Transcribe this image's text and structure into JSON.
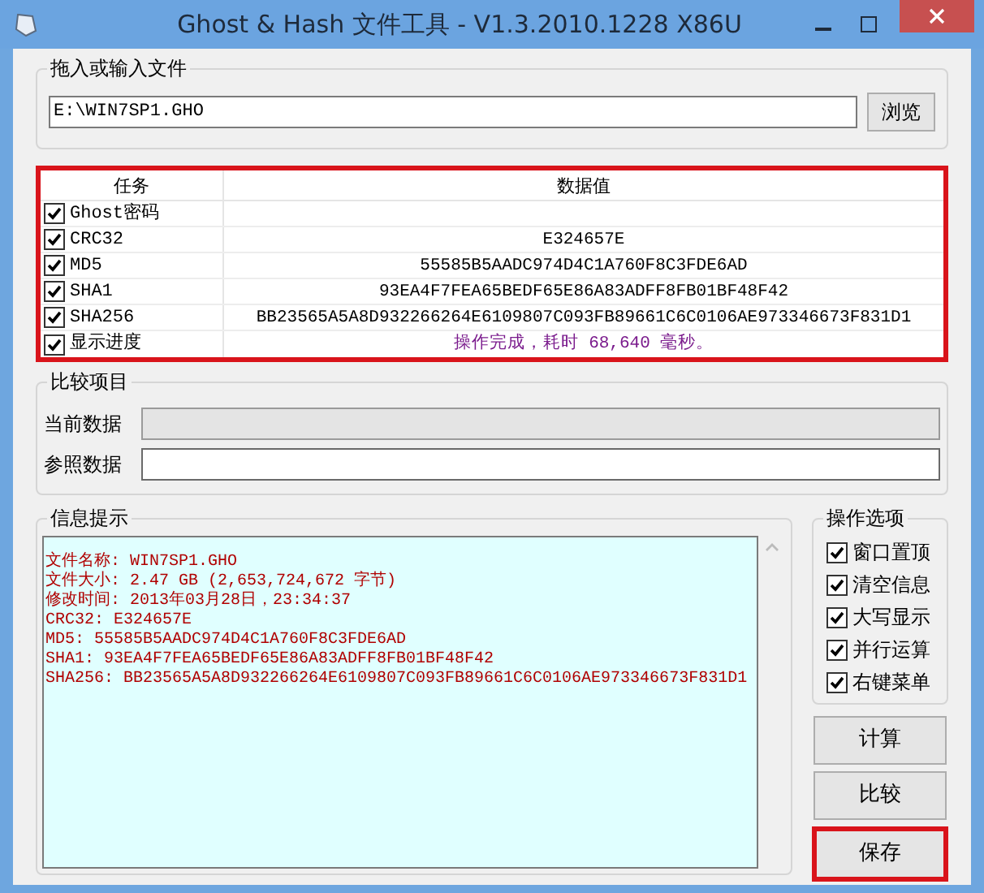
{
  "window": {
    "title": "Ghost & Hash 文件工具 - V1.3.2010.1228 X86U"
  },
  "file_group": {
    "label": "拖入或输入文件",
    "path": "E:\\WIN7SP1.GHO",
    "browse_button": "浏览"
  },
  "table": {
    "columns": [
      "任务",
      "数据值"
    ],
    "rows": [
      {
        "task": "Ghost密码",
        "checked": true,
        "value": ""
      },
      {
        "task": "CRC32",
        "checked": true,
        "value": "E324657E"
      },
      {
        "task": "MD5",
        "checked": true,
        "value": "55585B5AADC974D4C1A760F8C3FDE6AD"
      },
      {
        "task": "SHA1",
        "checked": true,
        "value": "93EA4F7FEA65BEDF65E86A83ADFF8FB01BF48F42"
      },
      {
        "task": "SHA256",
        "checked": true,
        "value": "BB23565A5A8D932266264E6109807C093FB89661C6C0106AE973346673F831D1"
      },
      {
        "task": "显示进度",
        "checked": true,
        "value": "操作完成，耗时 68,640 毫秒。",
        "kind": "status"
      }
    ]
  },
  "compare_group": {
    "label": "比较项目",
    "fields": [
      {
        "label": "当前数据",
        "disabled": true
      },
      {
        "label": "参照数据",
        "disabled": false
      }
    ]
  },
  "info_group": {
    "label": "信息提示",
    "lines": [
      "文件名称: WIN7SP1.GHO",
      "文件大小: 2.47 GB (2,653,724,672 字节)",
      "修改时间: 2013年03月28日，23:34:37",
      "CRC32: E324657E",
      "MD5: 55585B5AADC974D4C1A760F8C3FDE6AD",
      "SHA1: 93EA4F7FEA65BEDF65E86A83ADFF8FB01BF48F42",
      "SHA256: BB23565A5A8D932266264E6109807C093FB89661C6C0106AE973346673F831D1"
    ]
  },
  "options_group": {
    "label": "操作选项",
    "options": [
      {
        "label": "窗口置顶",
        "checked": true
      },
      {
        "label": "清空信息",
        "checked": true
      },
      {
        "label": "大写显示",
        "checked": true
      },
      {
        "label": "并行运算",
        "checked": true
      },
      {
        "label": "右键菜单",
        "checked": true
      }
    ]
  },
  "buttons": [
    {
      "label": "计算",
      "highlighted": false
    },
    {
      "label": "比较",
      "highlighted": false
    },
    {
      "label": "保存",
      "highlighted": true
    }
  ]
}
